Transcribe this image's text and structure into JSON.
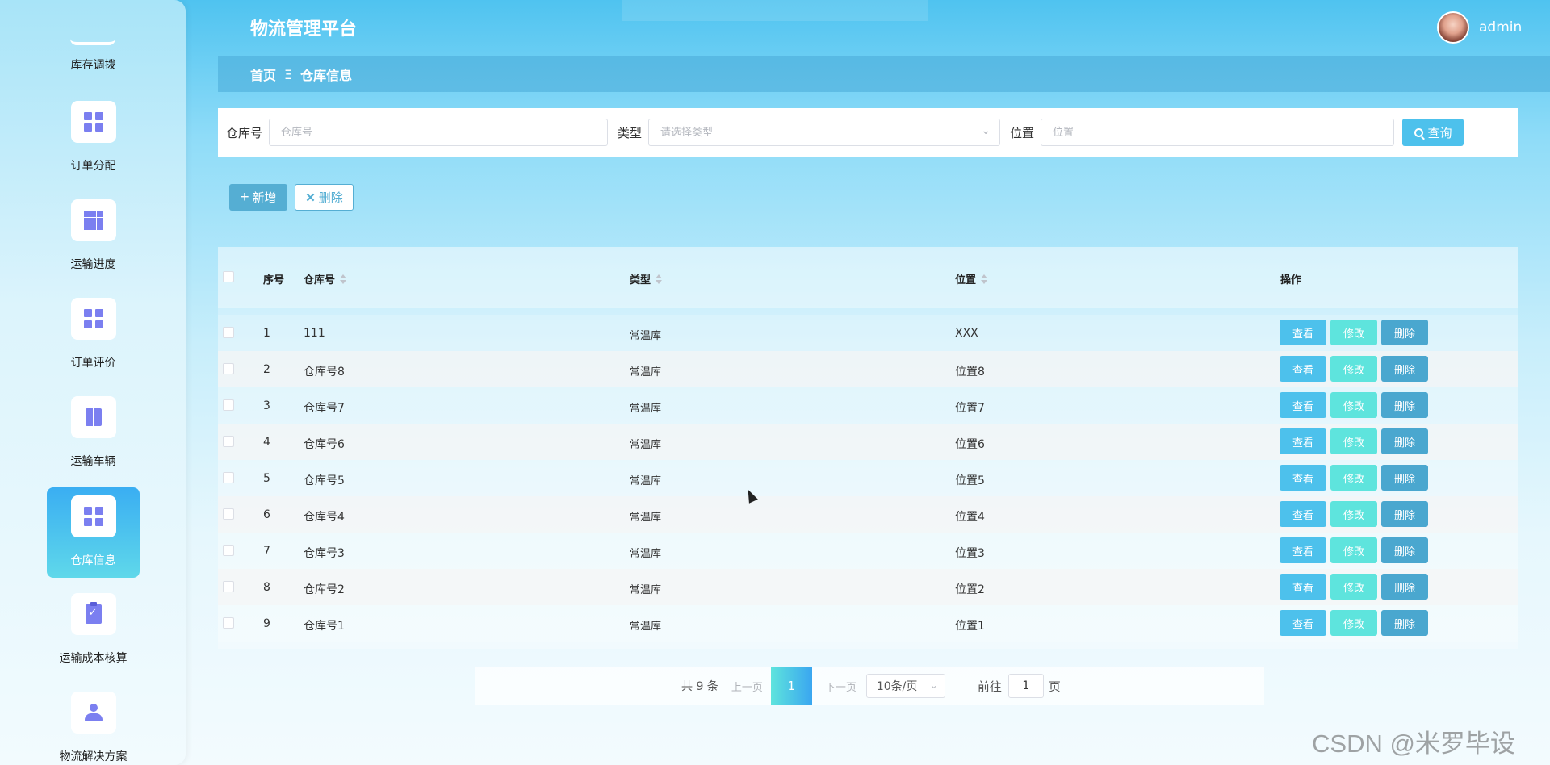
{
  "app": {
    "title": "物流管理平台",
    "username": "admin"
  },
  "sidebar": {
    "items": [
      {
        "label": "库存调拨",
        "icon": "minus-icon"
      },
      {
        "label": "订单分配",
        "icon": "grid-icon"
      },
      {
        "label": "运输进度",
        "icon": "table-grid-icon"
      },
      {
        "label": "订单评价",
        "icon": "grid-icon"
      },
      {
        "label": "运输车辆",
        "icon": "book-icon"
      },
      {
        "label": "仓库信息",
        "icon": "grid-icon",
        "active": true
      },
      {
        "label": "运输成本核算",
        "icon": "clipboard-check-icon"
      },
      {
        "label": "物流解决方案",
        "icon": "user-icon"
      }
    ]
  },
  "breadcrumb": {
    "home": "首页",
    "separator": "Ξ",
    "current": "仓库信息"
  },
  "search": {
    "warehouse_label": "仓库号",
    "warehouse_placeholder": "仓库号",
    "type_label": "类型",
    "type_placeholder": "请选择类型",
    "location_label": "位置",
    "location_placeholder": "位置",
    "query_button": "查询"
  },
  "actions": {
    "add": "新增",
    "delete": "删除"
  },
  "table": {
    "headers": {
      "index": "序号",
      "warehouse": "仓库号",
      "type": "类型",
      "location": "位置",
      "ops": "操作"
    },
    "op_labels": {
      "view": "查看",
      "edit": "修改",
      "delete": "删除"
    },
    "rows": [
      {
        "index": "1",
        "warehouse": "111",
        "type": "常温库",
        "location": "XXX"
      },
      {
        "index": "2",
        "warehouse": "仓库号8",
        "type": "常温库",
        "location": "位置8"
      },
      {
        "index": "3",
        "warehouse": "仓库号7",
        "type": "常温库",
        "location": "位置7"
      },
      {
        "index": "4",
        "warehouse": "仓库号6",
        "type": "常温库",
        "location": "位置6"
      },
      {
        "index": "5",
        "warehouse": "仓库号5",
        "type": "常温库",
        "location": "位置5"
      },
      {
        "index": "6",
        "warehouse": "仓库号4",
        "type": "常温库",
        "location": "位置4"
      },
      {
        "index": "7",
        "warehouse": "仓库号3",
        "type": "常温库",
        "location": "位置3"
      },
      {
        "index": "8",
        "warehouse": "仓库号2",
        "type": "常温库",
        "location": "位置2"
      },
      {
        "index": "9",
        "warehouse": "仓库号1",
        "type": "常温库",
        "location": "位置1"
      }
    ]
  },
  "pagination": {
    "total": "共 9 条",
    "prev": "上一页",
    "current_page": "1",
    "next": "下一页",
    "page_size": "10条/页",
    "goto_label": "前往",
    "goto_value": "1",
    "page_suffix": "页"
  },
  "watermark": "CSDN @米罗毕设"
}
